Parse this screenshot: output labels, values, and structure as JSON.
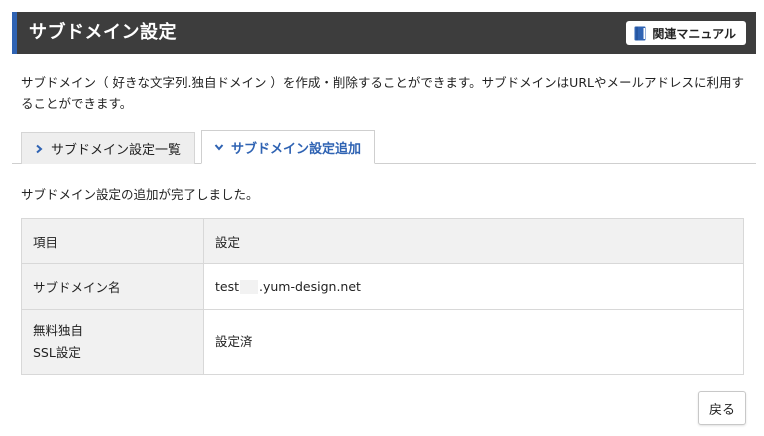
{
  "header": {
    "title": "サブドメイン設定",
    "manual_button": "関連マニュアル",
    "accent_color": "#2f63b3",
    "bar_color": "#3d3d3d"
  },
  "description": "サブドメイン（ 好きな文字列.独自ドメイン ）を作成・削除することができます。サブドメインはURLやメールアドレスに利用することができます。",
  "tabs": [
    {
      "label": "サブドメイン設定一覧",
      "icon": "chevron-right-icon",
      "active": false
    },
    {
      "label": "サブドメイン設定追加",
      "icon": "chevron-down-icon",
      "active": true
    }
  ],
  "message": "サブドメイン設定の追加が完了しました。",
  "table": {
    "header": {
      "col1": "項目",
      "col2": "設定"
    },
    "rows": [
      {
        "label": "サブドメイン名",
        "value_prefix": "test",
        "value_suffix": ".yum-design.net"
      },
      {
        "label_line1": "無料独自",
        "label_line2": "SSL設定",
        "value": "設定済"
      }
    ]
  },
  "back_button": "戻る"
}
